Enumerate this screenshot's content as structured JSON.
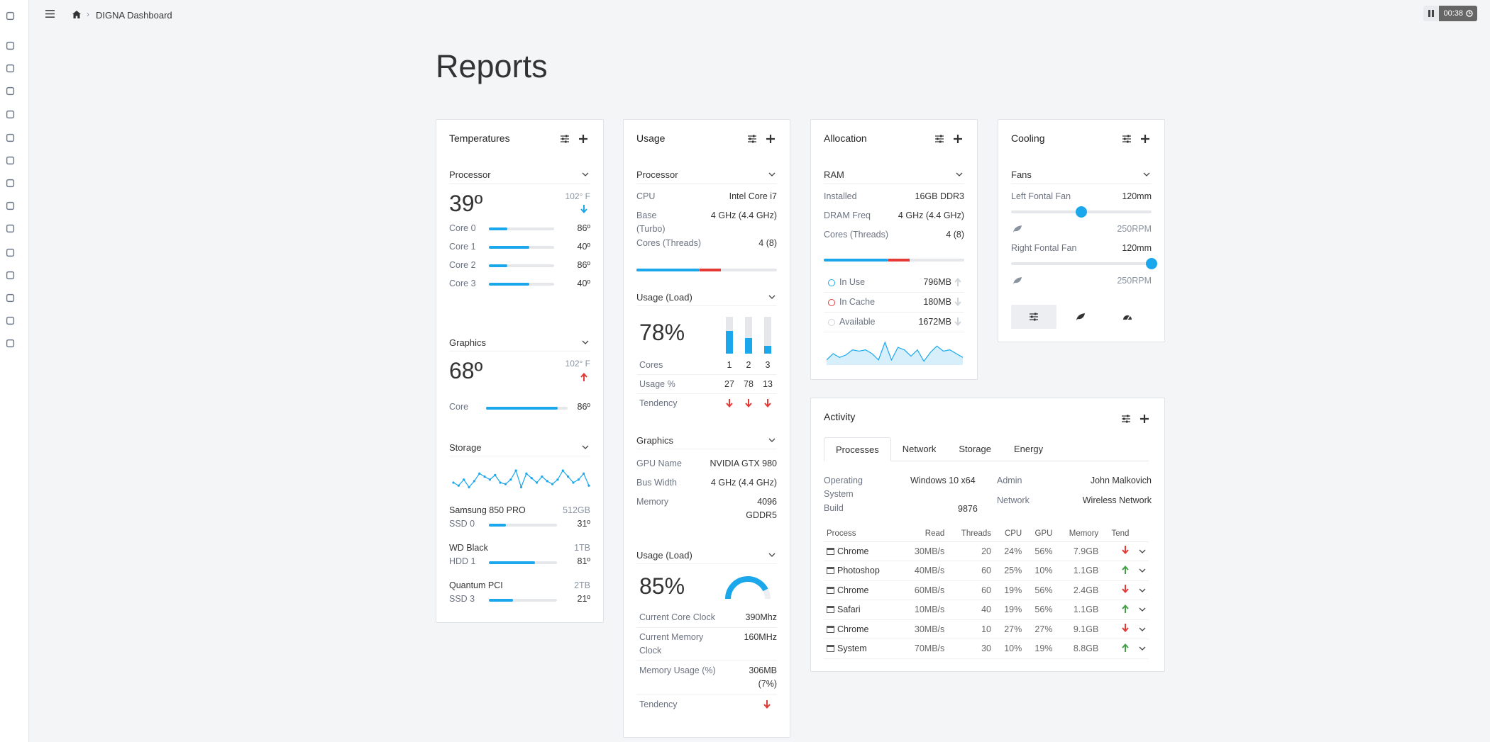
{
  "breadcrumb": {
    "current": "DIGNA Dashboard"
  },
  "timer": {
    "time": "00:38"
  },
  "page": {
    "title": "Reports"
  },
  "colors": {
    "accent": "#1aa7ec",
    "danger": "#e53935",
    "success": "#43a047"
  },
  "temperatures": {
    "title": "Temperatures",
    "processor": {
      "label": "Processor",
      "temp": "39º",
      "limit": "102° F",
      "cores": [
        {
          "label": "Core 0",
          "value": "86º",
          "level": 0.28
        },
        {
          "label": "Core 1",
          "value": "40º",
          "level": 0.62
        },
        {
          "label": "Core 2",
          "value": "86º",
          "level": 0.28
        },
        {
          "label": "Core 3",
          "value": "40º",
          "level": 0.62
        }
      ]
    },
    "graphics": {
      "label": "Graphics",
      "temp": "68º",
      "limit": "102° F",
      "core_label": "Core",
      "core_value": "86º",
      "core_level": 0.88
    },
    "storage": {
      "label": "Storage",
      "sparkline": [
        8,
        6,
        10,
        5,
        9,
        14,
        12,
        10,
        13,
        8,
        7,
        10,
        16,
        5,
        14,
        11,
        8,
        12,
        9,
        7,
        10,
        16,
        12,
        8,
        10,
        14,
        6
      ],
      "drives": [
        {
          "name": "Samsung 850 PRO",
          "size": "512GB",
          "sub": "SSD 0",
          "temp": "31º",
          "level": 0.25
        },
        {
          "name": "WD Black",
          "size": "1TB",
          "sub": "HDD 1",
          "temp": "81º",
          "level": 0.68
        },
        {
          "name": "Quantum PCI",
          "size": "2TB",
          "sub": "SSD 3",
          "temp": "21º",
          "level": 0.35
        }
      ]
    }
  },
  "usage": {
    "title": "Usage",
    "processor": {
      "label": "Processor",
      "cpu_label": "CPU",
      "cpu_value": "Intel Core i7",
      "base_label": "Base",
      "base_value": "4 GHz (4.4 GHz)",
      "turbo_label": "(Turbo)",
      "cores_label": "Cores (Threads)",
      "cores_value": "4 (8)",
      "bar_blue": 0.45,
      "bar_red": 0.15
    },
    "load": {
      "label": "Usage (Load)",
      "percent": "78%",
      "cores_label": "Cores",
      "cores": [
        "1",
        "2",
        "3"
      ],
      "usage_label": "Usage %",
      "usage": [
        "27",
        "78",
        "13"
      ],
      "tendency_label": "Tendency",
      "col_fills": [
        0.62,
        0.42,
        0.22
      ]
    },
    "graphics": {
      "label": "Graphics",
      "gpu_label": "GPU Name",
      "gpu_value": "NVIDIA GTX 980",
      "bus_label": "Bus Width",
      "bus_value": "4 GHz (4.4 GHz)",
      "mem_label": "Memory",
      "mem_value1": "4096",
      "mem_value2": "GDDR5"
    },
    "load2": {
      "label": "Usage (Load)",
      "percent": "85%",
      "gauge": 0.85,
      "core_clock_label": "Current Core Clock",
      "core_clock": "390Mhz",
      "mem_clock_label1": "Current Memory",
      "mem_clock_label2": "Clock",
      "mem_clock": "160MHz",
      "mem_usage_label": "Memory Usage (%)",
      "mem_usage1": "306MB",
      "mem_usage2": "(7%)",
      "tendency_label": "Tendency"
    }
  },
  "allocation": {
    "title": "Allocation",
    "section": "RAM",
    "installed_label": "Installed",
    "installed": "16GB DDR3",
    "dram_label": "DRAM Freq",
    "dram": "4 GHz (4.4 GHz)",
    "cores_label": "Cores (Threads)",
    "cores": "4 (8)",
    "bar_blue": 0.46,
    "bar_red": 0.15,
    "legend": [
      {
        "label": "In Use",
        "value": "796MB",
        "color": "#1aa7ec"
      },
      {
        "label": "In Cache",
        "value": "180MB",
        "color": "#e53935"
      },
      {
        "label": "Available",
        "value": "1672MB",
        "color": "#cfd4da"
      }
    ],
    "area": [
      4,
      9,
      6,
      8,
      12,
      11,
      12,
      9,
      4,
      18,
      4,
      14,
      12,
      7,
      12,
      3,
      10,
      15,
      11,
      12,
      9,
      6
    ]
  },
  "cooling": {
    "title": "Cooling",
    "section": "Fans",
    "left_label": "Left Fontal Fan",
    "left_size": "120mm",
    "left_rpm": "250RPM",
    "left_level": 0.5,
    "right_label": "Right Fontal Fan",
    "right_size": "120mm",
    "right_rpm": "250RPM",
    "right_level": 1.0
  },
  "activity": {
    "title": "Activity",
    "tabs": [
      "Processes",
      "Network",
      "Storage",
      "Energy"
    ],
    "os_label1": "Operating",
    "os_label2": "System",
    "os_value": "Windows 10 x64",
    "build_label": "Build",
    "build_value": "9876",
    "admin_label": "Admin",
    "admin_value": "John Malkovich",
    "network_label": "Network",
    "network_value": "Wireless Network",
    "headers": [
      "Process",
      "Read",
      "Threads",
      "CPU",
      "GPU",
      "Memory",
      "Tend"
    ],
    "rows": [
      {
        "name": "Chrome",
        "read": "30MB/s",
        "threads": "20",
        "cpu": "24%",
        "gpu": "56%",
        "mem": "7.9GB",
        "tend": "down"
      },
      {
        "name": "Photoshop",
        "read": "40MB/s",
        "threads": "60",
        "cpu": "25%",
        "gpu": "10%",
        "mem": "1.1GB",
        "tend": "up"
      },
      {
        "name": "Chrome",
        "read": "60MB/s",
        "threads": "60",
        "cpu": "19%",
        "gpu": "56%",
        "mem": "2.4GB",
        "tend": "down"
      },
      {
        "name": "Safari",
        "read": "10MB/s",
        "threads": "40",
        "cpu": "19%",
        "gpu": "56%",
        "mem": "1.1GB",
        "tend": "up"
      },
      {
        "name": "Chrome",
        "read": "30MB/s",
        "threads": "10",
        "cpu": "27%",
        "gpu": "27%",
        "mem": "9.1GB",
        "tend": "down"
      },
      {
        "name": "System",
        "read": "70MB/s",
        "threads": "30",
        "cpu": "10%",
        "gpu": "19%",
        "mem": "8.8GB",
        "tend": "up"
      }
    ]
  },
  "rail_icons": [
    "user-icon",
    "chart-line-icon",
    "home-icon",
    "grid-icon",
    "copy-icon",
    "columns-icon",
    "toggle-icon",
    "pie-chart-icon",
    "checkbox-icon",
    "board-icon",
    "pointer-icon",
    "clone-icon",
    "star-icon",
    "bookmark-icon",
    "folder-open-icon"
  ]
}
